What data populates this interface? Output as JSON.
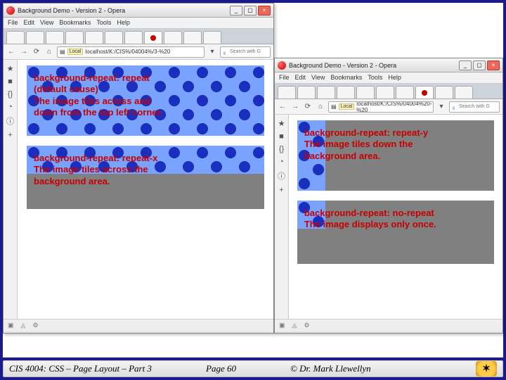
{
  "window_left": {
    "title": "Background Demo - Version 2 - Opera",
    "menu": [
      "File",
      "Edit",
      "View",
      "Bookmarks",
      "Tools",
      "Help"
    ],
    "url_local_tag": "Local",
    "url": "localhost/K:/CIS%/04004%/3-%20",
    "search_placeholder": "Search with G",
    "sidebar_icons": [
      "★",
      "■",
      "{}",
      "◔",
      "ⓘ",
      "+"
    ],
    "demos": [
      {
        "id": "repeat",
        "text": "background-repeat: repeat\n(default cause)\nThe image tiles across and\ndown from the top left corner."
      },
      {
        "id": "repeat-x",
        "text": "background-repeat: repeat-x\nThe image tiles across the\nbackground area."
      }
    ],
    "status_icons": [
      "▣",
      "◬",
      "⚙"
    ]
  },
  "window_right": {
    "title": "Background Demo - Version 2 - Opera",
    "menu": [
      "File",
      "Edit",
      "View",
      "Bookmarks",
      "Tools",
      "Help"
    ],
    "url_local_tag": "Local",
    "url": "localhost/K:/CIS%/04004%20-%20",
    "search_placeholder": "Search with G",
    "sidebar_icons": [
      "★",
      "■",
      "{}",
      "◔",
      "ⓘ",
      "+"
    ],
    "demos": [
      {
        "id": "repeat-y",
        "text": "background-repeat: repeat-y\nThe image tiles down the\nbackground area."
      },
      {
        "id": "no-repeat",
        "text": "background-repeat: no-repeat\nThe image displays only once."
      }
    ],
    "status_icons": [
      "▣",
      "◬",
      "⚙"
    ]
  },
  "footer": {
    "course": "CIS 4004: CSS – Page Layout – Part 3",
    "page": "Page 60",
    "author": "© Dr. Mark Llewellyn"
  }
}
